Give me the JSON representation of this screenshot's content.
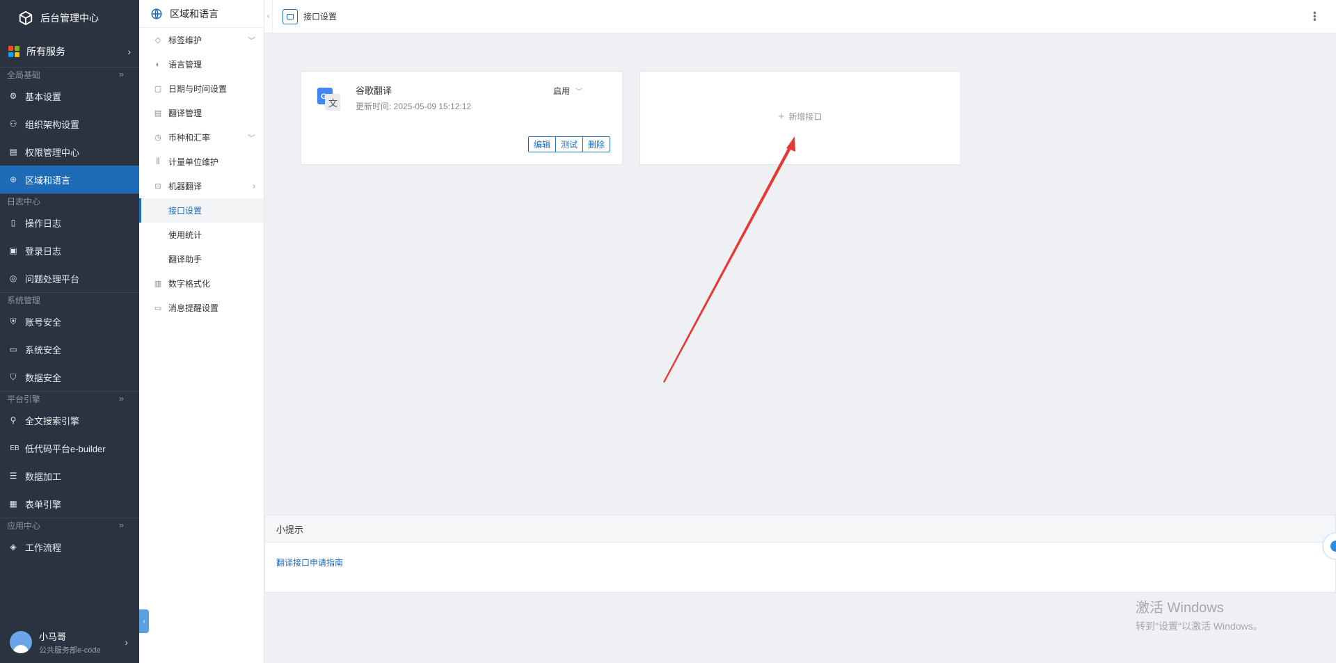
{
  "brand": {
    "title": "后台管理中心"
  },
  "all_services": {
    "label": "所有服务"
  },
  "sidebar": {
    "groups": [
      {
        "title": "全局基础",
        "items": [
          {
            "label": "基本设置",
            "icon": "gear-icon"
          },
          {
            "label": "组织架构设置",
            "icon": "org-icon"
          },
          {
            "label": "权限管理中心",
            "icon": "permission-icon"
          },
          {
            "label": "区域和语言",
            "icon": "globe-icon",
            "active": true
          }
        ]
      },
      {
        "title": "日志中心",
        "items": [
          {
            "label": "操作日志",
            "icon": "document-icon"
          },
          {
            "label": "登录日志",
            "icon": "login-log-icon"
          },
          {
            "label": "问题处理平台",
            "icon": "planet-icon"
          }
        ]
      },
      {
        "title": "系统管理",
        "items": [
          {
            "label": "账号安全",
            "icon": "shield-icon"
          },
          {
            "label": "系统安全",
            "icon": "monitor-icon"
          },
          {
            "label": "数据安全",
            "icon": "shield-check-icon"
          }
        ]
      },
      {
        "title": "平台引擎",
        "items": [
          {
            "label": "全文搜索引擎",
            "icon": "search-icon"
          },
          {
            "label": "低代码平台e-builder",
            "icon": "eb-icon"
          },
          {
            "label": "数据加工",
            "icon": "table-icon"
          },
          {
            "label": "表单引擎",
            "icon": "form-icon"
          }
        ]
      },
      {
        "title": "应用中心",
        "items": [
          {
            "label": "工作流程",
            "icon": "layers-icon"
          }
        ]
      }
    ]
  },
  "user": {
    "name": "小马哥",
    "dept": "公共服务部e-code"
  },
  "submenu": {
    "title": "区域和语言",
    "items": [
      {
        "label": "标签维护",
        "icon": "tag-icon",
        "arrow": "down"
      },
      {
        "label": "语言管理",
        "icon": "language-icon"
      },
      {
        "label": "日期与时间设置",
        "icon": "calendar-icon"
      },
      {
        "label": "翻译管理",
        "icon": "translate-icon"
      },
      {
        "label": "币种和汇率",
        "icon": "currency-icon",
        "arrow": "down"
      },
      {
        "label": "计量单位维护",
        "icon": "unit-icon"
      },
      {
        "label": "机器翻译",
        "icon": "robot-icon",
        "arrow": "right"
      }
    ],
    "sub_items": [
      "接口设置",
      "使用统计",
      "翻译助手"
    ],
    "items_after": [
      {
        "label": "数字格式化",
        "icon": "number-format-icon"
      },
      {
        "label": "消息提醒设置",
        "icon": "message-icon"
      }
    ]
  },
  "topbar": {
    "title": "接口设置"
  },
  "api_card": {
    "name": "谷歌翻译",
    "time_label": "更新时间: 2025-05-09 15:12:12",
    "status": "启用",
    "buttons": [
      "编辑",
      "测试",
      "删除"
    ]
  },
  "add_card": {
    "label": "新增接口"
  },
  "tips": {
    "title": "小提示",
    "link": "翻译接口申请指南"
  },
  "watermark": {
    "line1": "激活 Windows",
    "line2": "转到\"设置\"以激活 Windows。"
  },
  "colors": {
    "sidebar_bg": "#2b3340",
    "accent": "#1e6bb8",
    "annotation_arrow": "#e53935"
  }
}
